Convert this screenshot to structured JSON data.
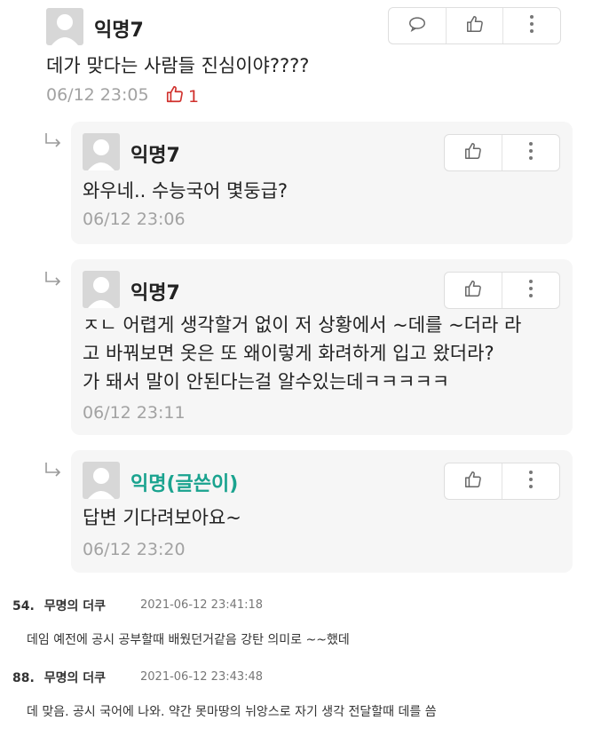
{
  "comments": [
    {
      "nick": "익명7",
      "lines": [
        "데가 맞다는 사람들 진심이야????"
      ],
      "time": "06/12 23:05",
      "likes": "1"
    },
    {
      "nick": "익명7",
      "lines": [
        "와우네.. 수능국어 몇둥급?"
      ],
      "time": "06/12 23:06"
    },
    {
      "nick": "익명7",
      "lines": [
        "ㅈㄴ 어렵게 생각할거 없이 저 상황에서 ~데를 ~더라 라",
        "고 바꿔보면 옷은 또 왜이렇게 화려하게 입고 왔더라?",
        "가 돼서 말이 안된다는걸 알수있는데ㅋㅋㅋㅋㅋ"
      ],
      "time": "06/12 23:11"
    },
    {
      "nick": "익명(글쓴이)",
      "lines": [
        "답변 기다려보아요~"
      ],
      "time": "06/12 23:20"
    }
  ],
  "posts": [
    {
      "num": "54.",
      "name": "무명의 더쿠",
      "date": "2021-06-12 23:41:18",
      "text": "데임 예전에 공시 공부할때 배웠던거같음 강탄 의미로 ~~했데"
    },
    {
      "num": "88.",
      "name": "무명의 더쿠",
      "date": "2021-06-12 23:43:48",
      "text": "데 맞음. 공시 국어에 나와. 약간 못마땅의 뉘앙스로 자기 생각 전달할때 데를 씀"
    }
  ],
  "icons": {
    "comment": "speech-bubble-icon",
    "like": "thumbs-up-icon",
    "more": "more-vertical-icon",
    "reply": "reply-arrow-icon"
  },
  "colors": {
    "author_nick": "#1aa38f",
    "like_active": "#d0312d",
    "reply_bg": "#f6f6f6",
    "timestamp": "#a2a2a2"
  }
}
